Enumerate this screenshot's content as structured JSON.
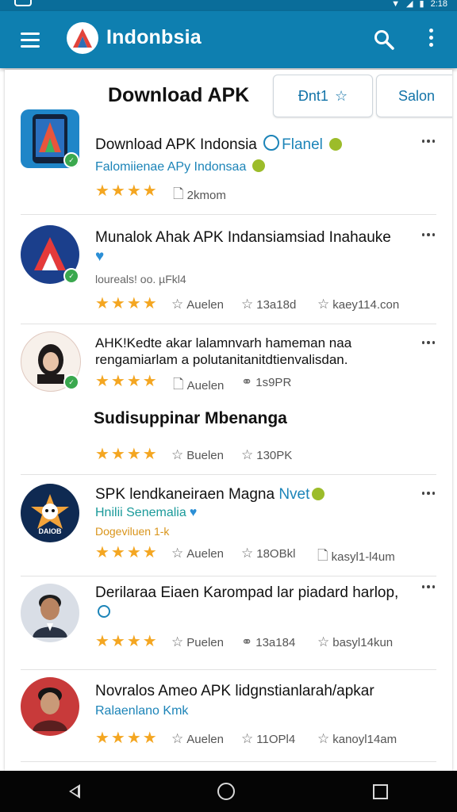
{
  "status_bar": {
    "time": "2:18"
  },
  "app_bar": {
    "title": "Indonbsia"
  },
  "page": {
    "title": "Download APK",
    "rate_button": "Ðnt1",
    "sale_button": "Salon"
  },
  "items": [
    {
      "name": "Download APK Indonsia",
      "name_tag": "Flanel",
      "subtitle": "Falomiienae APy Indonsaa",
      "meta1": "2kmom"
    },
    {
      "name": "Munalok Ahak APK Indansiamsiad Inahauke",
      "subtitle": "loureals! oo. µFkl4",
      "meta1": "Auelen",
      "meta2": "13a18d",
      "meta3": "kaey114.con"
    },
    {
      "name": "AHK!Kedte akar lalamnvarh hameman naa rengamiarlam a polutanitanitdtienvalisdan.",
      "meta1": "Auelen",
      "meta2": "1s9PR"
    },
    {
      "name": "Sudisuppinar Mbenanga",
      "meta1": "Buelen",
      "meta2": "130PK"
    },
    {
      "name": "SPK lendkaneiraen Magna",
      "name_tag": "Nvet",
      "subtitle": "Hnilii Senemalia",
      "subtitle2": "Dogeviluen 1-k",
      "meta1": "Auelen",
      "meta2": "18OBkl",
      "meta3": "kasyl1-l4um"
    },
    {
      "name": "Derilaraa Eiaen Karompad lar piadard harlop,",
      "meta1": "Puelen",
      "meta2": "13a184",
      "meta3": "basyl14kun"
    },
    {
      "name": "Novralos Ameo APK lidgnstianlarah/apkar",
      "subtitle": "Ralaenlano Kmk",
      "meta1": "Auelen",
      "meta2": "11OPl4",
      "meta3": "kanoyl14am"
    }
  ],
  "colors": {
    "appbar": "#0e7fb0",
    "star": "#f4a621",
    "link": "#1c84b8",
    "badge_green": "#3aa84e"
  }
}
